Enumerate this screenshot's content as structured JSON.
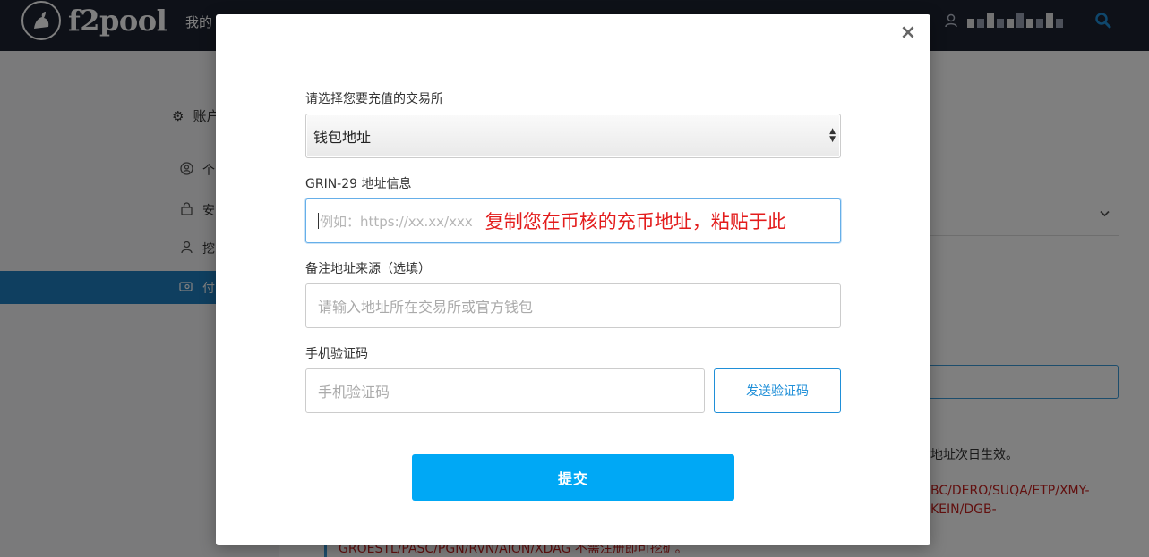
{
  "header": {
    "logo_text": "f2pool",
    "nav_mine": "我的",
    "user_icon": "user-icon",
    "search_icon": "search-icon"
  },
  "sidebar": {
    "head": {
      "icon": "gear-icon",
      "label": "账户"
    },
    "items": [
      {
        "icon": "personal-icon",
        "label": "个"
      },
      {
        "icon": "lock-icon",
        "label": "安"
      },
      {
        "icon": "worker-icon",
        "label": "挖"
      },
      {
        "icon": "payment-icon",
        "label": "付",
        "active": true
      }
    ]
  },
  "background": {
    "notice": "地址次日生效。",
    "red_line_1": "BC/DERO/SUQA/ETP/XMY-",
    "red_line_2": "KEIN/DGB-",
    "red_line_3": "GROESTL/PASC/PGN/RVN/AION/XDAG 不需注册即可挖矿。"
  },
  "modal": {
    "close_icon": "×",
    "exchange_label": "请选择您要充值的交易所",
    "exchange_selected": "钱包地址",
    "address_label": "GRIN-29 地址信息",
    "address_placeholder": "例如：https://xx.xx/xxx",
    "address_annotation": "复制您在币核的充币地址，粘贴于此",
    "remark_label": "备注地址来源（选填）",
    "remark_placeholder": "请输入地址所在交易所或官方钱包",
    "code_label": "手机验证码",
    "code_placeholder": "手机验证码",
    "send_code_button": "发送验证码",
    "submit_button": "提交"
  },
  "colors": {
    "accent": "#00a8f5",
    "link_blue": "#1f8fd8",
    "annotation_red": "#e31c1c",
    "topbar": "#1c2230"
  }
}
